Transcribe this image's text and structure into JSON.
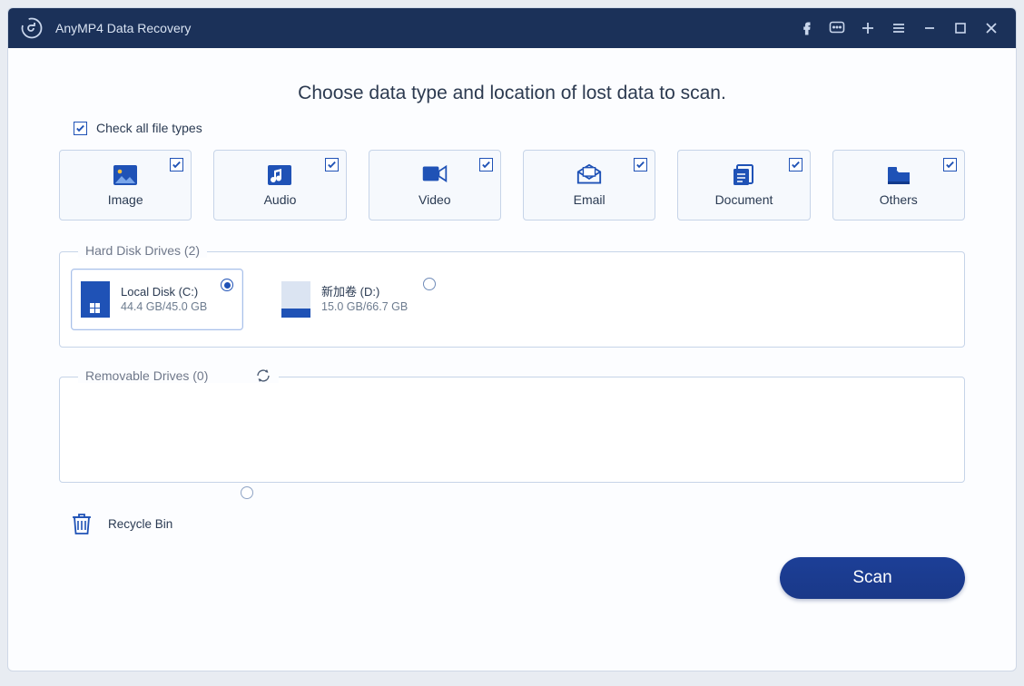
{
  "titlebar": {
    "title": "AnyMP4 Data Recovery"
  },
  "headline": "Choose data type and location of lost data to scan.",
  "check_all": {
    "label": "Check all file types",
    "checked": true
  },
  "types": [
    {
      "key": "image",
      "label": "Image",
      "checked": true
    },
    {
      "key": "audio",
      "label": "Audio",
      "checked": true
    },
    {
      "key": "video",
      "label": "Video",
      "checked": true
    },
    {
      "key": "email",
      "label": "Email",
      "checked": true
    },
    {
      "key": "document",
      "label": "Document",
      "checked": true
    },
    {
      "key": "others",
      "label": "Others",
      "checked": true
    }
  ],
  "hdd": {
    "legend": "Hard Disk Drives (2)",
    "drives": [
      {
        "name": "Local Disk (C:)",
        "size": "44.4 GB/45.0 GB",
        "selected": true,
        "style": "windows"
      },
      {
        "name": "新加卷 (D:)",
        "size": "15.0 GB/66.7 GB",
        "selected": false,
        "style": "partial"
      }
    ]
  },
  "removable": {
    "legend": "Removable Drives (0)"
  },
  "recycle": {
    "label": "Recycle Bin",
    "selected": false
  },
  "scan_label": "Scan"
}
